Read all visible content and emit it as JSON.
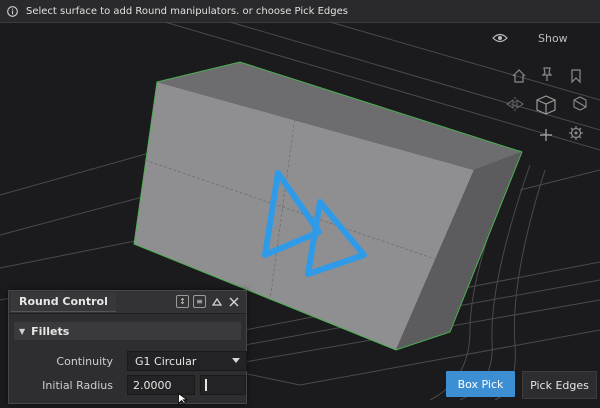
{
  "topbar": {
    "icon": "info-icon",
    "message": "Select surface to add Round manipulators. or choose Pick Edges"
  },
  "viewport": {
    "show_label": "Show",
    "eye_icon": "eye-icon",
    "view_tools": [
      "home-icon",
      "pin-icon",
      "bookmark-icon",
      "mirror-icon",
      "view-cube-icon",
      "section-icon",
      "add-icon",
      "gear-icon"
    ],
    "colors": {
      "accent": "#3c8fd2",
      "selection_edge": "#4caf50",
      "part": "#8e8e8e",
      "background": "#1b1b1d"
    }
  },
  "panel": {
    "title": "Round Control",
    "header_icons": [
      "resize-icon",
      "list-icon",
      "collapse-icon",
      "close-icon"
    ],
    "section": "Fillets",
    "fields": {
      "continuity_label": "Continuity",
      "continuity_value": "G1 Circular",
      "radius_label": "Initial Radius",
      "radius_value": "2.0000"
    }
  },
  "buttons": {
    "box_pick": "Box Pick",
    "pick_edges": "Pick Edges"
  }
}
